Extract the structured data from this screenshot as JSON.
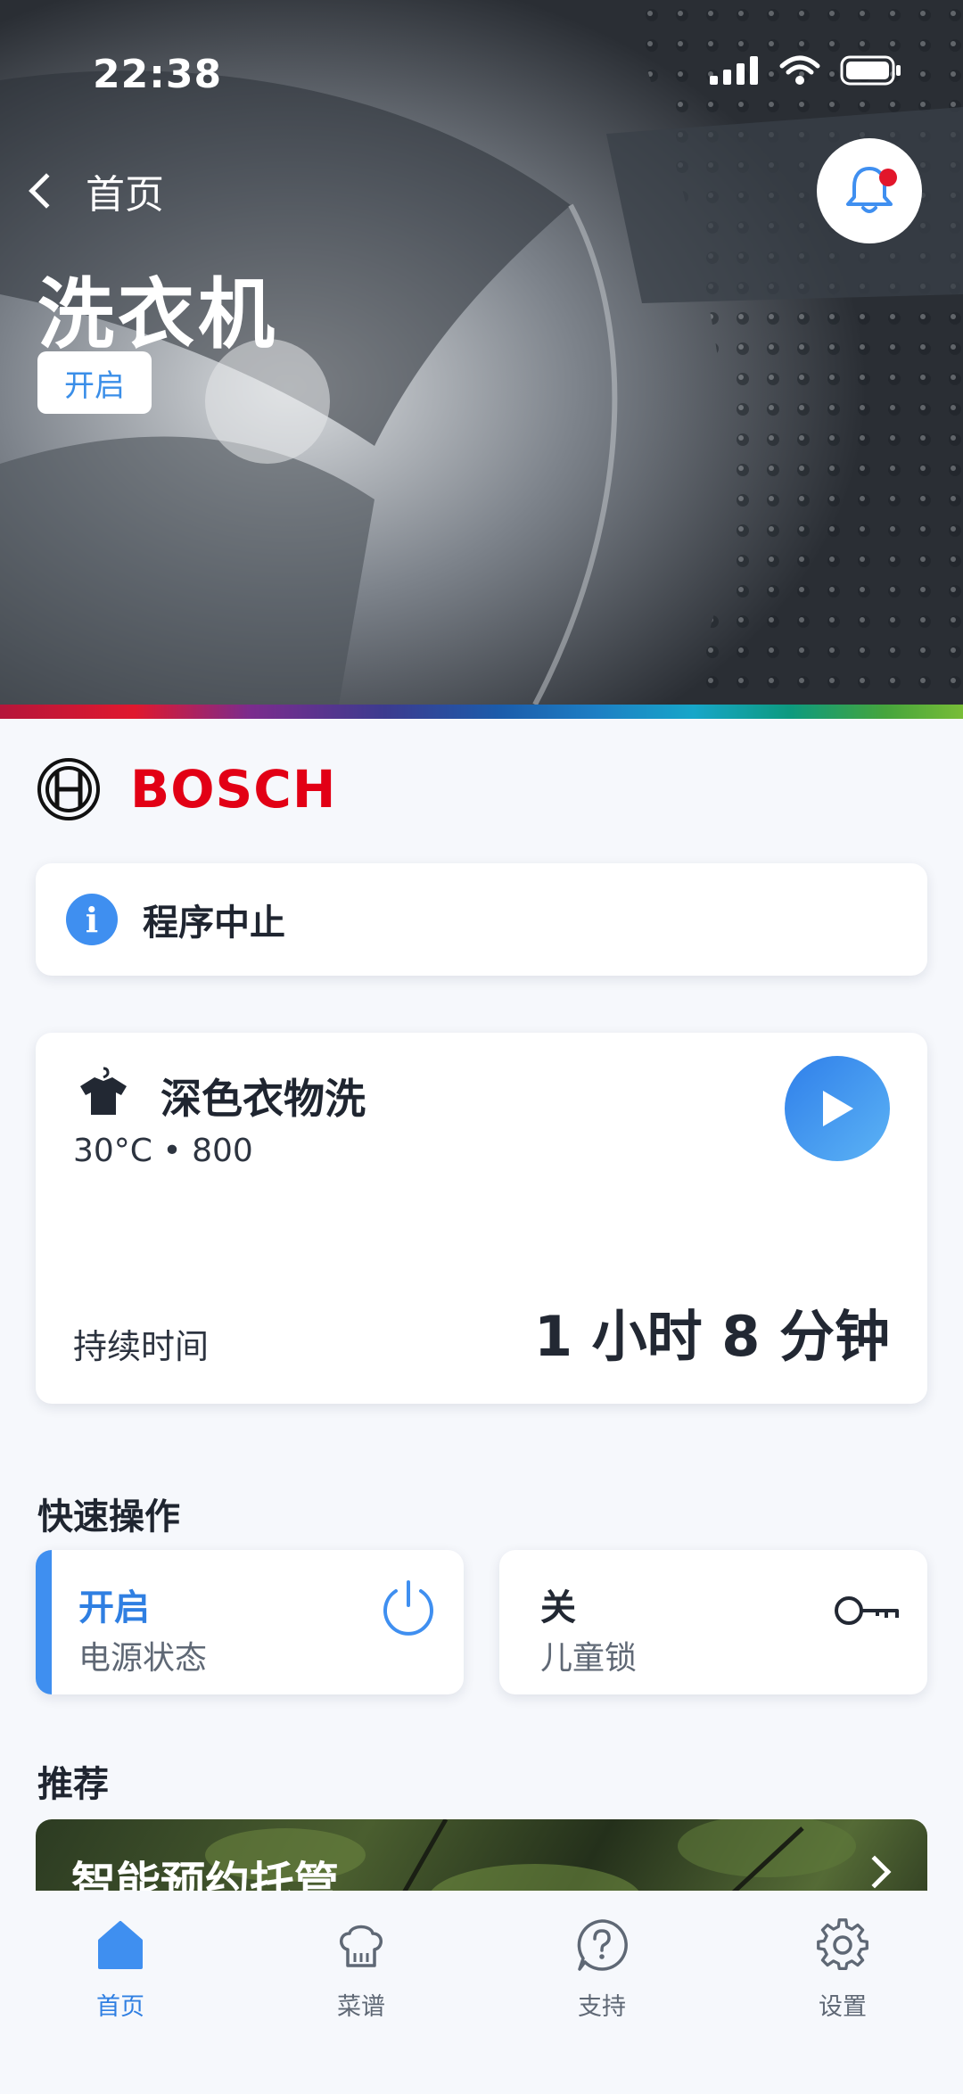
{
  "status_bar": {
    "time": "22:38"
  },
  "header": {
    "back_label": "首页",
    "title": "洗衣机",
    "status_chip": "开启"
  },
  "brand": {
    "name": "BOSCH"
  },
  "info": {
    "message": "程序中止"
  },
  "program": {
    "name": "深色衣物洗",
    "details": "30°C • 800",
    "duration_label": "持续时间",
    "duration_value": "1 小时 8 分钟"
  },
  "quick_actions": {
    "title": "快速操作",
    "items": [
      {
        "value": "开启",
        "label": "电源状态",
        "icon": "power-icon"
      },
      {
        "value": "关",
        "label": "儿童锁",
        "icon": "key-icon"
      }
    ]
  },
  "recommend": {
    "title": "推荐",
    "banner_text": "智能预约托管"
  },
  "tabs": [
    {
      "label": "首页",
      "icon": "home-icon",
      "active": true
    },
    {
      "label": "菜谱",
      "icon": "chef-hat-icon",
      "active": false
    },
    {
      "label": "支持",
      "icon": "help-icon",
      "active": false
    },
    {
      "label": "设置",
      "icon": "gear-icon",
      "active": false
    }
  ],
  "colors": {
    "accent": "#3f8ff0",
    "brand": "#e20015",
    "alert_dot": "#e2162b"
  }
}
